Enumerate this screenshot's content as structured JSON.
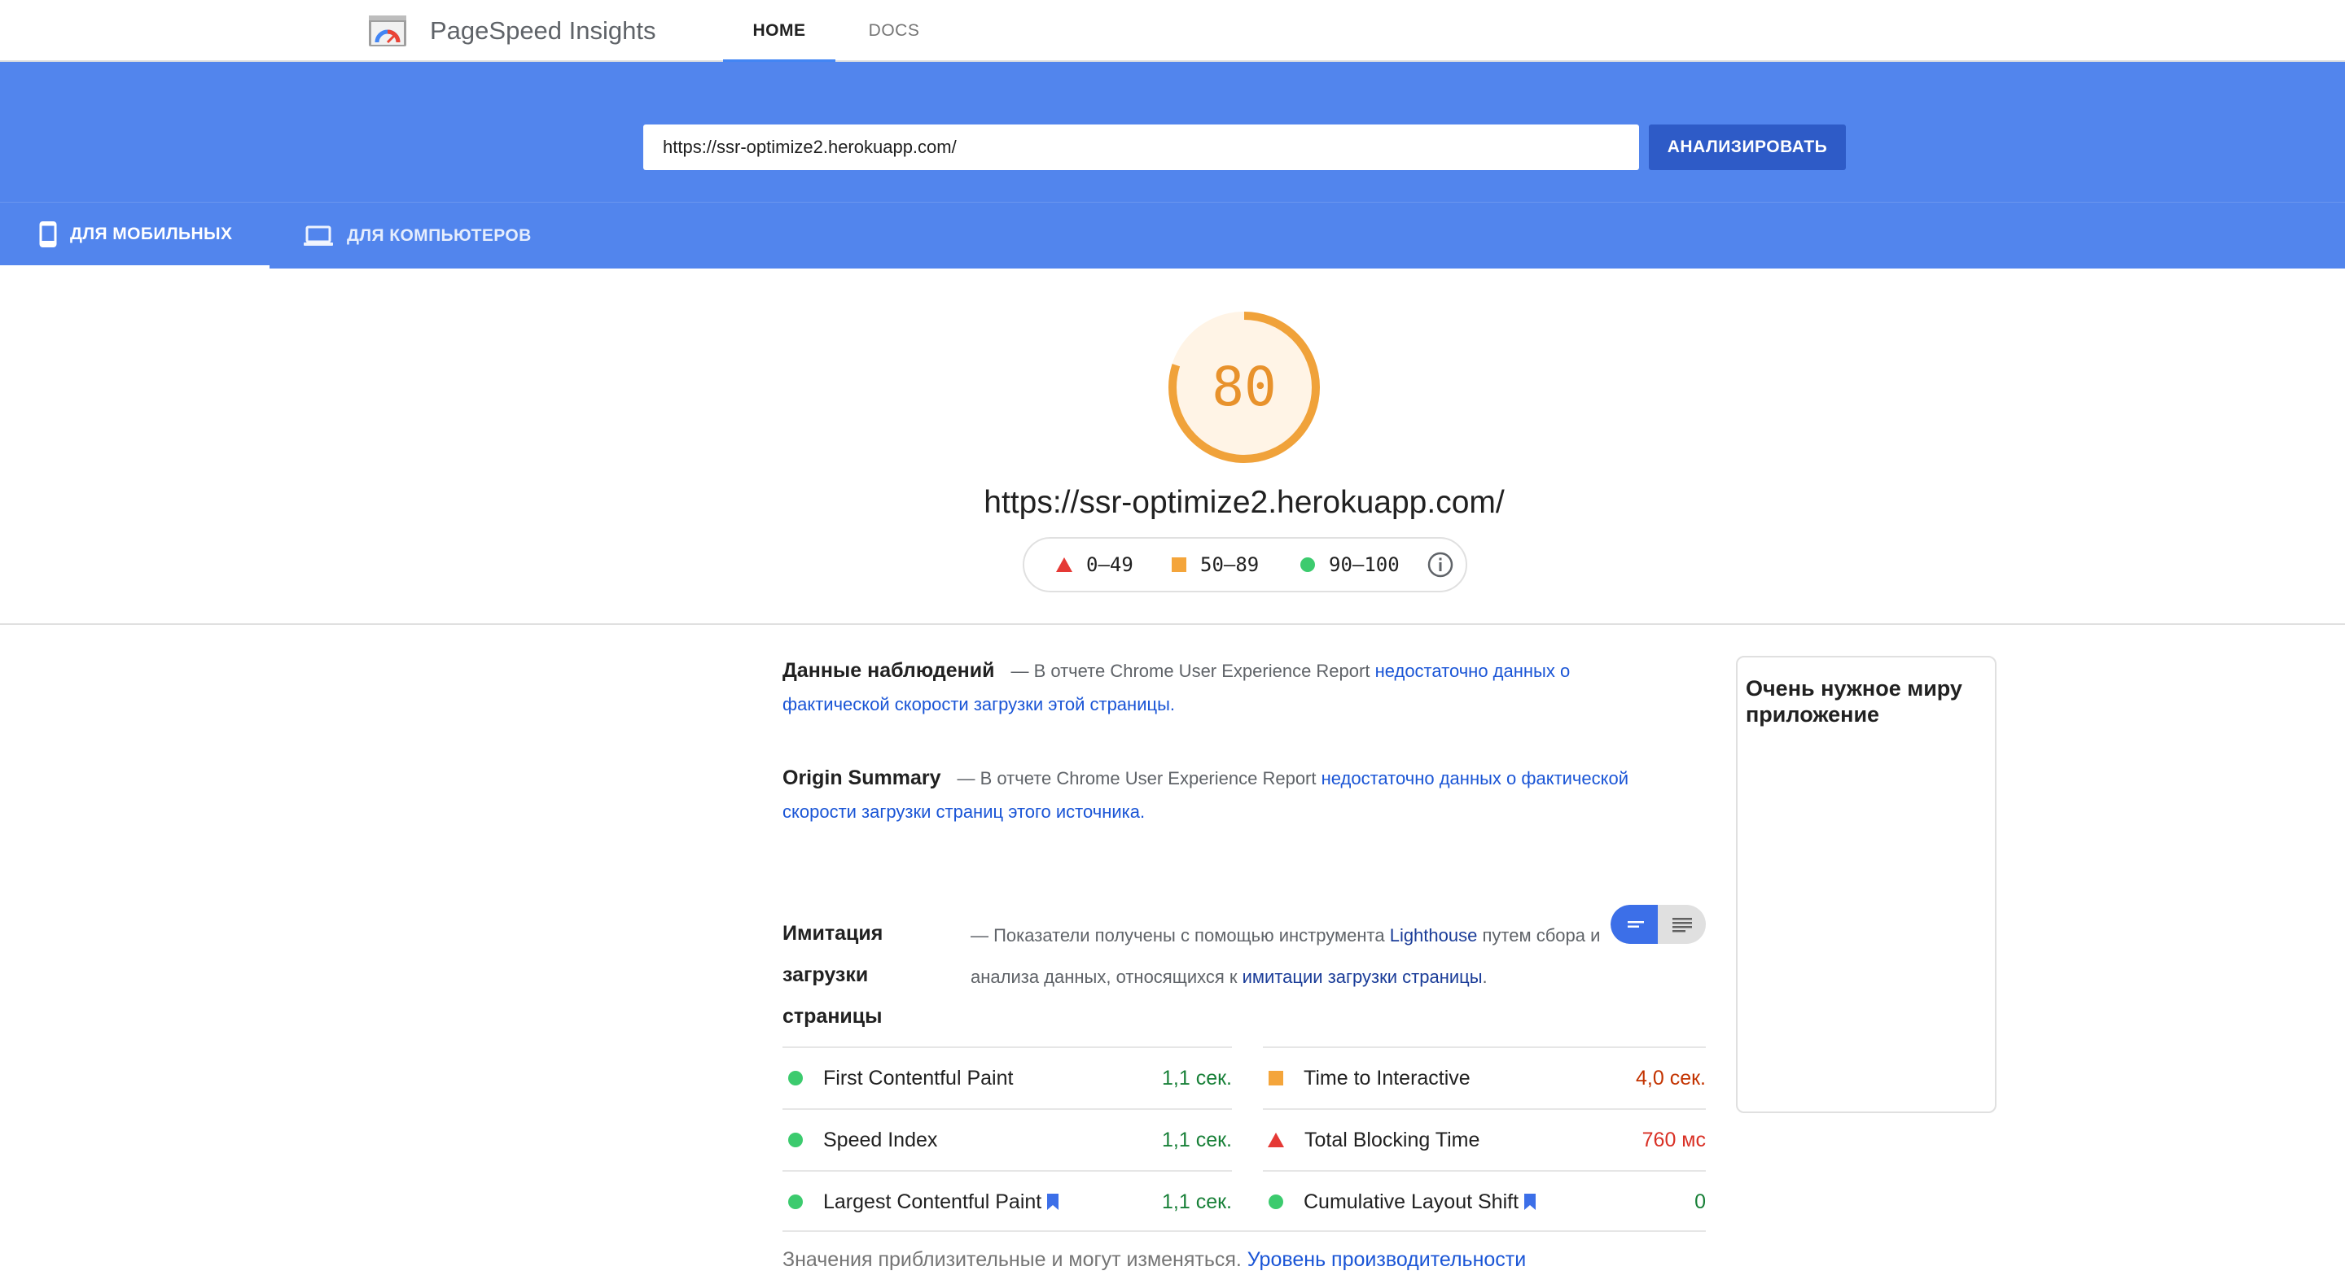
{
  "header": {
    "brand": "PageSpeed Insights",
    "nav": [
      {
        "label": "HOME",
        "active": true
      },
      {
        "label": "DOCS",
        "active": false
      }
    ]
  },
  "search": {
    "url_value": "https://ssr-optimize2.herokuapp.com/",
    "analyze_label": "АНАЛИЗИРОВАТЬ"
  },
  "device_tabs": [
    {
      "label": "ДЛЯ МОБИЛЬНЫХ",
      "icon": "phone-icon",
      "active": true
    },
    {
      "label": "ДЛЯ КОМПЬЮТЕРОВ",
      "icon": "laptop-icon",
      "active": false
    }
  ],
  "score": {
    "value": "80",
    "fraction": 0.8,
    "color": "#f0a23a"
  },
  "page_url": "https://ssr-optimize2.herokuapp.com/",
  "legend": [
    {
      "range": "0–49",
      "shape": "triangle",
      "color": "#e53935"
    },
    {
      "range": "50–89",
      "shape": "square",
      "color": "#f4a53b"
    },
    {
      "range": "90–100",
      "shape": "circle",
      "color": "#3ccb6e"
    }
  ],
  "field_data": {
    "title": "Данные наблюдений",
    "prefix": "— В отчете Chrome User Experience Report",
    "link": "недостаточно данных о фактической скорости загрузки этой страницы."
  },
  "origin_summary": {
    "title": "Origin Summary",
    "prefix": "— В отчете Chrome User Experience Report",
    "link": "недостаточно данных о фактической скорости загрузки страниц этого источника."
  },
  "lab_data": {
    "title": "Имитация загрузки страницы",
    "prefix": "— Показатели получены с помощью инструмента",
    "lighthouse_link": "Lighthouse",
    "middle": "путем сбора и анализа данных, относящихся к",
    "simulation_link": "имитации загрузки страницы",
    "suffix": "."
  },
  "metrics": [
    {
      "name": "First Contentful Paint",
      "value": "1,1 сек.",
      "status": "good",
      "bookmark": false
    },
    {
      "name": "Time to Interactive",
      "value": "4,0 сек.",
      "status": "average",
      "bookmark": false
    },
    {
      "name": "Speed Index",
      "value": "1,1 сек.",
      "status": "good",
      "bookmark": false
    },
    {
      "name": "Total Blocking Time",
      "value": "760 мс",
      "status": "poor",
      "bookmark": false
    },
    {
      "name": "Largest Contentful Paint",
      "value": "1,1 сек.",
      "status": "good",
      "bookmark": true
    },
    {
      "name": "Cumulative Layout Shift",
      "value": "0",
      "status": "good",
      "bookmark": true
    }
  ],
  "footnote": {
    "text": "Значения приблизительные и могут изменяться.",
    "link": "Уровень производительности"
  },
  "side_card": {
    "title": "Очень нужное миру приложение"
  },
  "colors": {
    "band": "#5285ed",
    "button": "#2e5bc7",
    "link": "#1a55d6",
    "good": "#3ccb6e",
    "average": "#f4a53b",
    "poor": "#e53935"
  }
}
